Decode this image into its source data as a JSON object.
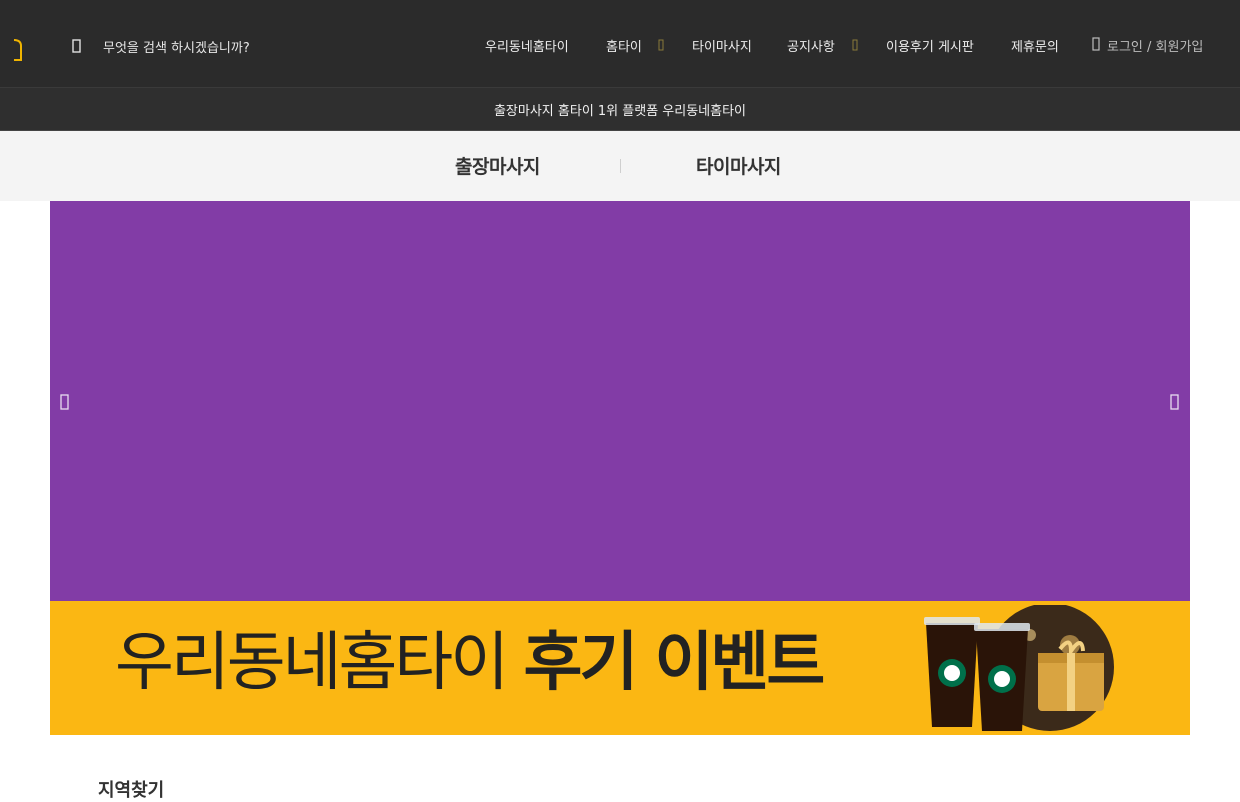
{
  "header": {
    "search_placeholder": "무엇을 검색 하시겠습니까?",
    "nav": [
      {
        "label": "우리동네홈타이",
        "has_dropdown": false
      },
      {
        "label": "홈타이",
        "has_dropdown": true
      },
      {
        "label": "타이마사지",
        "has_dropdown": false
      },
      {
        "label": "공지사항",
        "has_dropdown": true
      },
      {
        "label": "이용후기 게시판",
        "has_dropdown": false
      },
      {
        "label": "제휴문의",
        "has_dropdown": false
      }
    ],
    "login_label": "로그인 / 회원가입"
  },
  "subbar": {
    "text": "출장마사지 홈타이 1위 플랫폼 우리동네홈타이"
  },
  "category_tabs": [
    "출장마사지",
    "타이마사지"
  ],
  "slider": {
    "background": "#823ca6",
    "prev_icon": "chevron-left-icon",
    "next_icon": "chevron-right-icon"
  },
  "banner": {
    "background": "#fbb713",
    "title_regular": "우리동네홈타이",
    "title_bold": "후기 이벤트"
  },
  "section": {
    "title": "지역찾기"
  },
  "colors": {
    "accent": "#f0b400",
    "topbar": "#2b2b2b",
    "caret": "#8a7a3a"
  }
}
